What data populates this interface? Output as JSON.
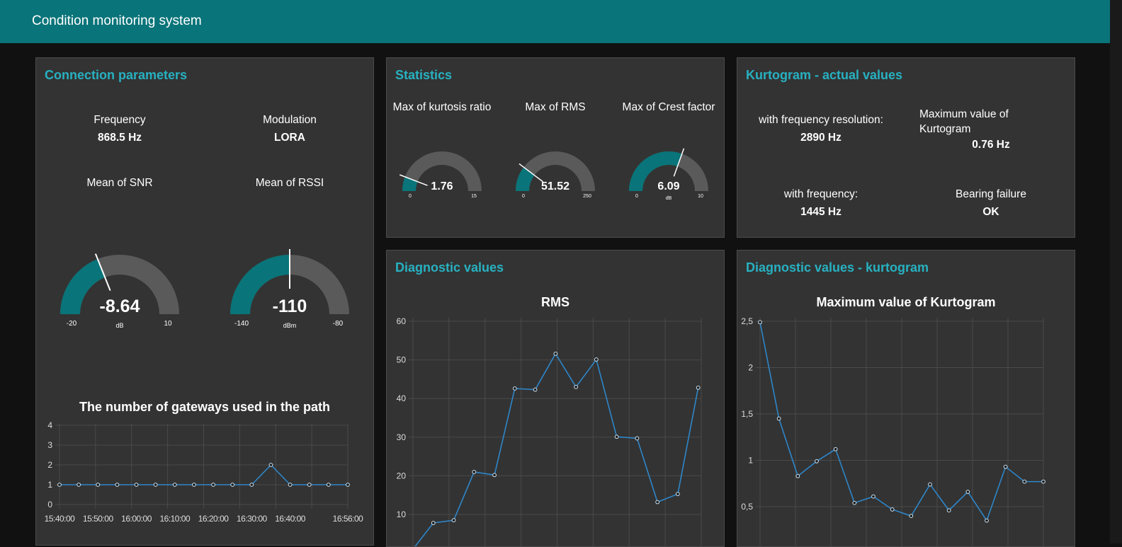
{
  "app": {
    "title": "Condition monitoring system"
  },
  "colors": {
    "accent": "#097479",
    "panel_title": "#27b1c1",
    "gauge_fill": "#097479",
    "gauge_track": "#5a5a5a",
    "line": "#2e86c9"
  },
  "connection": {
    "title": "Connection parameters",
    "frequency": {
      "label": "Frequency",
      "value": "868.5 Hz"
    },
    "modulation": {
      "label": "Modulation",
      "value": "LORA"
    },
    "snr": {
      "label": "Mean of SNR",
      "value": "-8.64",
      "min": "-20",
      "max": "10",
      "unit": "dB",
      "fraction": 0.379
    },
    "rssi": {
      "label": "Mean of RSSI",
      "value": "-110",
      "min": "-140",
      "max": "-80",
      "unit": "dBm",
      "fraction": 0.5
    }
  },
  "statistics": {
    "title": "Statistics",
    "kurtosis": {
      "label": "Max of kurtosis ratio",
      "value": "1.76",
      "min": "0",
      "max": "15",
      "unit": "",
      "fraction": 0.117
    },
    "rms": {
      "label": "Max of RMS",
      "value": "51.52",
      "min": "0",
      "max": "250",
      "unit": "",
      "fraction": 0.206
    },
    "crest": {
      "label": "Max of Crest factor",
      "value": "6.09",
      "min": "0",
      "max": "10",
      "unit": "dB",
      "fraction": 0.609
    }
  },
  "kurtogram": {
    "title": "Kurtogram - actual values",
    "resolution": {
      "label": "with frequency resolution:",
      "value": "2890 Hz"
    },
    "max_value": {
      "label": "Maximum value of Kurtogram",
      "value": "0.76 Hz"
    },
    "frequency": {
      "label": "with frequency:",
      "value": "1445 Hz"
    },
    "bearing": {
      "label": "Bearing failure",
      "value": "OK"
    }
  },
  "diagnostic": {
    "title": "Diagnostic values"
  },
  "diagnostic_kurtogram": {
    "title": "Diagnostic values - kurtogram"
  },
  "chart_data": [
    {
      "type": "line",
      "title": "The number of gateways used in the path",
      "x": [
        "15:40:00",
        "15:45:00",
        "15:50:00",
        "15:55:00",
        "16:00:00",
        "16:05:00",
        "16:10:00",
        "16:15:00",
        "16:20:00",
        "16:25:00",
        "16:30:00",
        "16:35:00",
        "16:40:00",
        "16:45:00",
        "16:50:00",
        "16:56:00"
      ],
      "values": [
        1,
        1,
        1,
        1,
        1,
        1,
        1,
        1,
        1,
        1,
        1,
        2,
        1,
        1,
        1,
        1
      ],
      "x_tick_labels": [
        "15:40:00",
        "15:50:00",
        "16:00:00",
        "16:10:00",
        "16:20:00",
        "16:30:00",
        "16:40:00",
        "16:56:00"
      ],
      "y_ticks": [
        "0",
        "1",
        "2",
        "3",
        "4"
      ],
      "ylim": [
        0,
        4
      ],
      "grid": true
    },
    {
      "type": "line",
      "title": "RMS",
      "values": [
        1,
        7.8,
        8.5,
        21,
        20.2,
        42.6,
        42.3,
        51.6,
        43,
        50.1,
        30.1,
        29.7,
        13.2,
        15.3,
        42.8
      ],
      "y_ticks": [
        "10",
        "20",
        "30",
        "40",
        "50",
        "60"
      ],
      "ylim_visible": [
        7.3,
        60
      ],
      "grid": true
    },
    {
      "type": "line",
      "title": "Maximum value of Kurtogram",
      "values": [
        2.49,
        1.45,
        0.83,
        0.99,
        1.12,
        0.54,
        0.61,
        0.47,
        0.4,
        0.74,
        0.46,
        0.66,
        0.35,
        0.93,
        0.77,
        0.77
      ],
      "y_ticks": [
        "0,5",
        "1",
        "1,5",
        "2",
        "2,5"
      ],
      "ylim_visible": [
        0.31,
        2.5
      ],
      "grid": true
    }
  ]
}
